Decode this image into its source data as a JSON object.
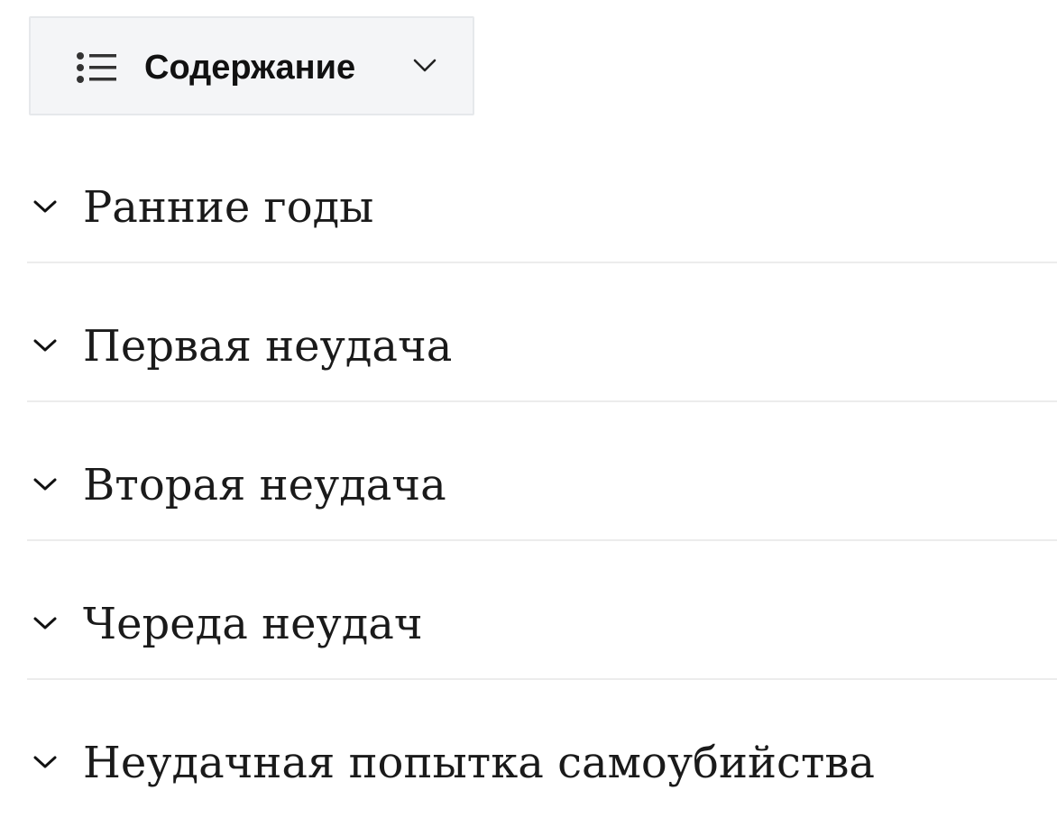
{
  "toc": {
    "title": "Содержание",
    "toggle_icon": "list-icon",
    "expand_icon": "chevron-down-icon"
  },
  "sections": [
    {
      "label": "Ранние годы",
      "icon": "chevron-down-icon"
    },
    {
      "label": "Первая неудача",
      "icon": "chevron-down-icon"
    },
    {
      "label": "Вторая неудача",
      "icon": "chevron-down-icon"
    },
    {
      "label": "Череда неудач",
      "icon": "chevron-down-icon"
    },
    {
      "label": "Неудачная попытка самоубийства",
      "icon": "chevron-down-icon"
    }
  ],
  "colors": {
    "button_background": "#f4f5f7",
    "button_border": "#e6e8eb",
    "text": "#1a1a1a",
    "divider": "#ececec"
  }
}
